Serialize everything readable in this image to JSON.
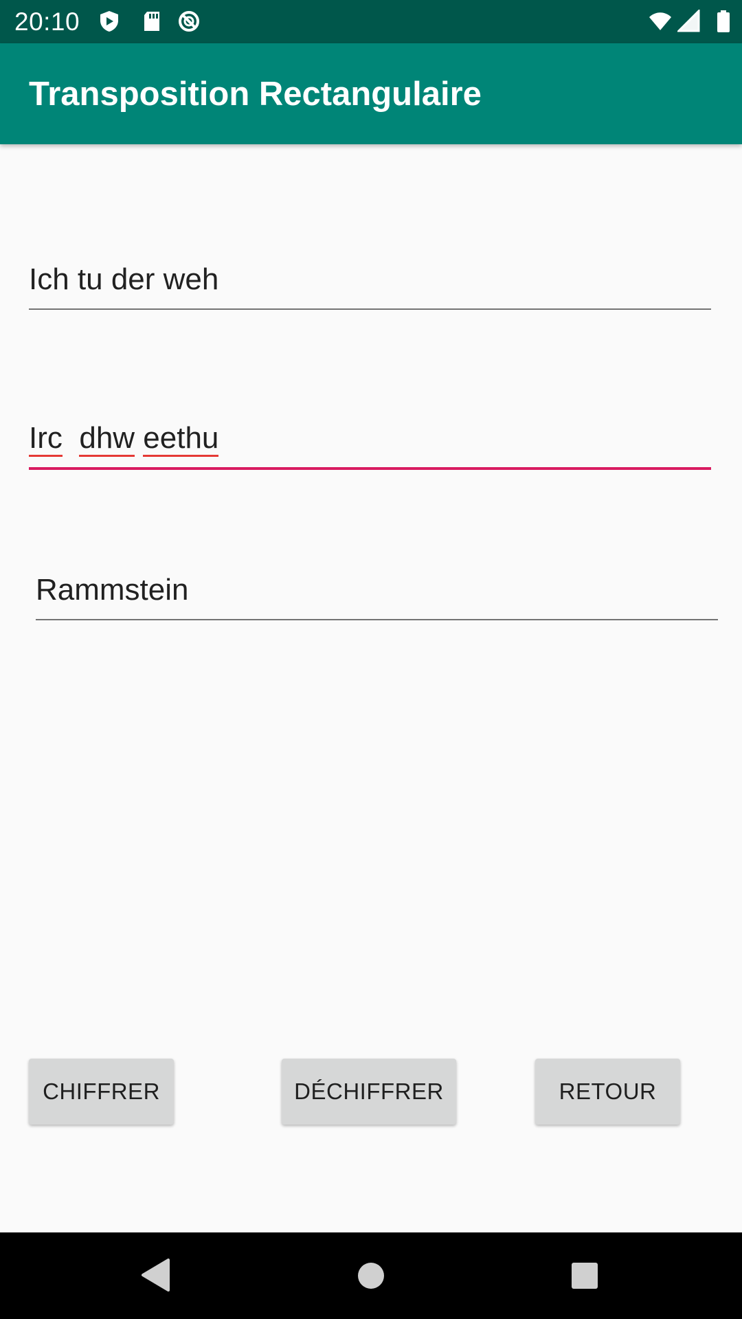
{
  "status_bar": {
    "time": "20:10",
    "left_icons": [
      "play-protect-icon",
      "sd-card-icon",
      "data-saver-icon"
    ],
    "right_icons": [
      "wifi-icon",
      "cell-signal-icon",
      "battery-icon"
    ]
  },
  "app_bar": {
    "title": "Transposition Rectangulaire",
    "color": "#008577"
  },
  "fields": {
    "plaintext": {
      "value": "Ich tu der weh"
    },
    "ciphertext": {
      "word1": "Irc",
      "gap": "  ",
      "word2": "dhw",
      "space": " ",
      "word3": "eethu",
      "accent": "#d81b60"
    },
    "key": {
      "value": "Rammstein"
    }
  },
  "buttons": {
    "encrypt": "CHIFFRER",
    "decrypt": "DÉCHIFFRER",
    "back": "RETOUR"
  },
  "nav_bar": {
    "icons": [
      "back-icon",
      "home-icon",
      "recents-icon"
    ]
  }
}
